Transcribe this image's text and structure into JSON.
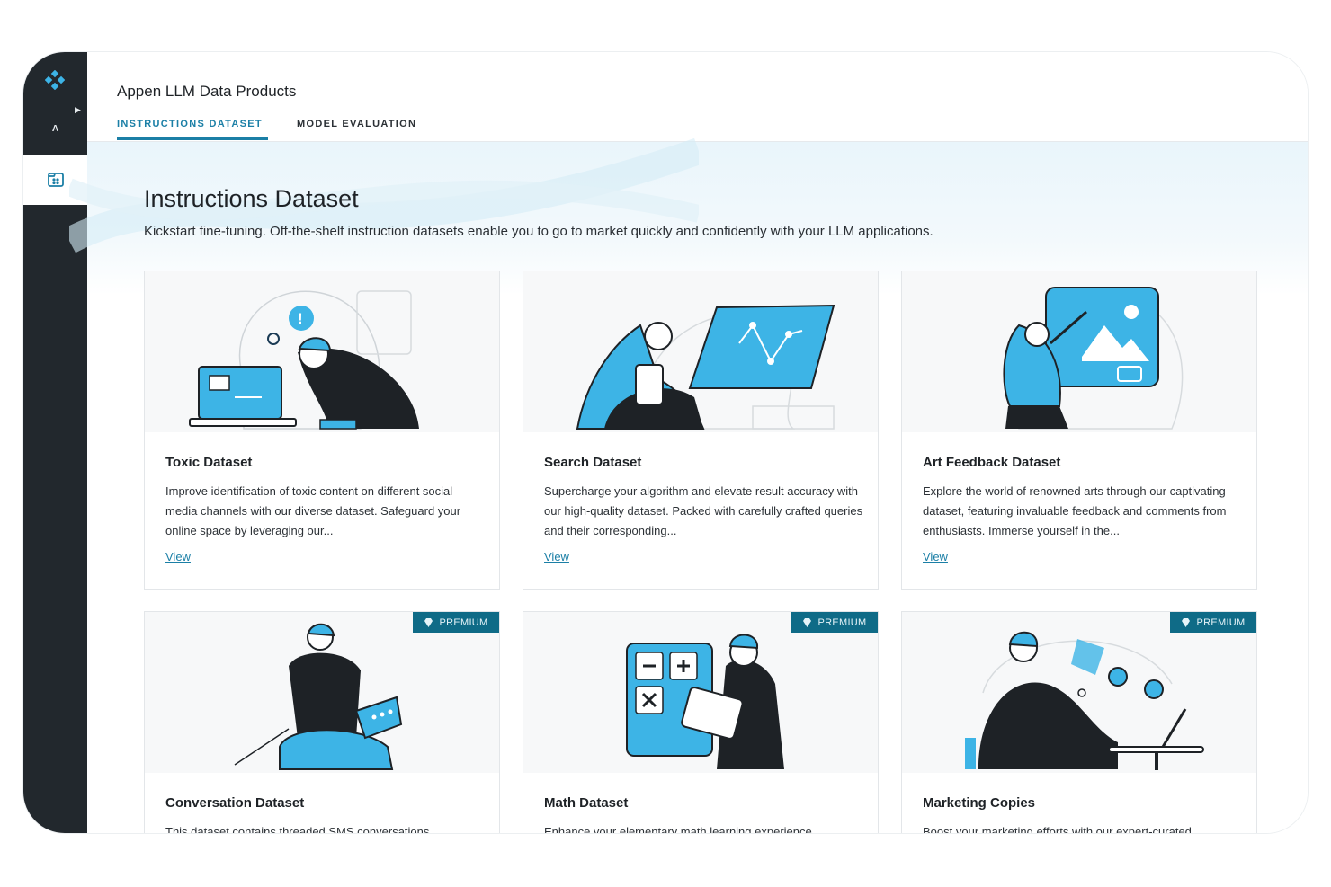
{
  "colors": {
    "sidebar": "#22282d",
    "accent": "#1b7fa6",
    "illustration": "#3db4e6",
    "premium_badge": "#0f6b87"
  },
  "sidebar": {
    "avatar_initial": "A",
    "logo_icon": "appen-logo-icon",
    "active_item_icon": "dataset-icon"
  },
  "header": {
    "app_title": "Appen LLM Data Products",
    "tabs": [
      {
        "label": "INSTRUCTIONS DATASET",
        "active": true
      },
      {
        "label": "MODEL EVALUATION",
        "active": false
      }
    ]
  },
  "page": {
    "title": "Instructions Dataset",
    "subtitle": "Kickstart fine-tuning. Off-the-shelf instruction datasets enable you to go to market quickly and confidently with your LLM applications."
  },
  "cards": [
    {
      "title": "Toxic Dataset",
      "description": "Improve identification of toxic content on different social media channels with our diverse dataset. Safeguard your online space by leveraging our...",
      "link": "View",
      "premium": false
    },
    {
      "title": "Search Dataset",
      "description": "Supercharge your algorithm and elevate result accuracy with our high-quality dataset. Packed with carefully crafted queries and their corresponding...",
      "link": "View",
      "premium": false
    },
    {
      "title": "Art Feedback Dataset",
      "description": "Explore the world of renowned arts through our captivating dataset, featuring invaluable feedback and comments from enthusiasts. Immerse yourself in the...",
      "link": "View",
      "premium": false
    },
    {
      "title": "Conversation Dataset",
      "description": "This dataset contains threaded SMS conversations",
      "premium": true,
      "badge": "PREMIUM"
    },
    {
      "title": "Math Dataset",
      "description": "Enhance your elementary math learning experience",
      "premium": true,
      "badge": "PREMIUM"
    },
    {
      "title": "Marketing Copies",
      "description": "Boost your marketing efforts with our expert-curated",
      "premium": true,
      "badge": "PREMIUM"
    }
  ]
}
